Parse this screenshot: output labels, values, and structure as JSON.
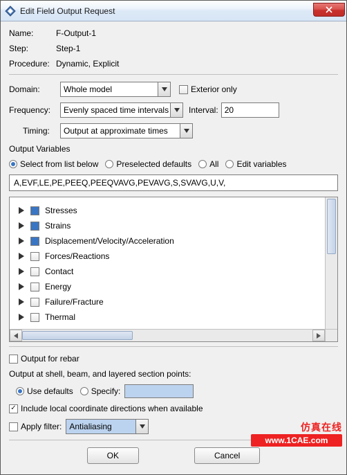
{
  "window": {
    "title": "Edit Field Output Request"
  },
  "fields": {
    "name_label": "Name:",
    "name_value": "F-Output-1",
    "step_label": "Step:",
    "step_value": "Step-1",
    "proc_label": "Procedure:",
    "proc_value": "Dynamic, Explicit",
    "domain_label": "Domain:",
    "domain_value": "Whole model",
    "exterior_label": "Exterior only",
    "freq_label": "Frequency:",
    "freq_value": "Evenly spaced time intervals",
    "interval_label": "Interval:",
    "interval_value": "20",
    "timing_label": "Timing:",
    "timing_value": "Output at approximate times"
  },
  "outvars": {
    "heading": "Output Variables",
    "radios": {
      "select": "Select from list below",
      "preselected": "Preselected defaults",
      "all": "All",
      "edit": "Edit variables"
    },
    "list_value": "A,EVF,LE,PE,PEEQ,PEEQVAVG,PEVAVG,S,SVAVG,U,V,"
  },
  "tree": [
    {
      "label": "Stresses",
      "checked": true
    },
    {
      "label": "Strains",
      "checked": true
    },
    {
      "label": "Displacement/Velocity/Acceleration",
      "checked": true
    },
    {
      "label": "Forces/Reactions",
      "checked": false
    },
    {
      "label": "Contact",
      "checked": false
    },
    {
      "label": "Energy",
      "checked": false
    },
    {
      "label": "Failure/Fracture",
      "checked": false
    },
    {
      "label": "Thermal",
      "checked": false
    }
  ],
  "bottom": {
    "rebar": "Output for rebar",
    "section_heading": "Output at shell, beam, and layered section points:",
    "use_defaults": "Use defaults",
    "specify": "Specify:",
    "include_local": "Include local coordinate directions when available",
    "apply_filter": "Apply filter:",
    "filter_value": "Antialiasing"
  },
  "buttons": {
    "ok": "OK",
    "cancel": "Cancel"
  },
  "watermark": {
    "top": "仿真在线",
    "bottom": "www.1CAE.com"
  }
}
